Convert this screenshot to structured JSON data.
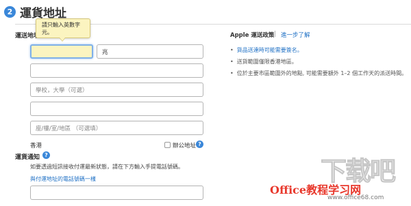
{
  "header": {
    "step_number": "2",
    "title": "運貨地址"
  },
  "form": {
    "address_label": "運送地址",
    "tooltip_text": "請只輸入英數字元。",
    "first_name_value": "",
    "last_name_value": "兆",
    "address_line1_value": "",
    "address_line2_placeholder": "學校，大學（可選）",
    "address_line3_value": "",
    "address_line4_placeholder": "座/樓/室/地區 （可選填）",
    "region": "香港",
    "office_checkbox_label": "辦公地址",
    "notify_label": "運貨通知",
    "notify_description": "如要透過短訊接收付運最新狀態，請在下方輸入手提電話號碼。",
    "notify_link": "與付運地址的電話號碼一樣",
    "phone_value": ""
  },
  "policy": {
    "title": "Apple 運送政策",
    "separator": "|",
    "learn_more": "進一步了解",
    "bullets": [
      "貨品送達時可能需要簽名。",
      "送貨範圍僅限香港地區。",
      "位於主要市區範圍外的地點, 可能需要額外 1–2 個工作天的派送時間。"
    ]
  },
  "watermark": {
    "logo_text": "下载吧",
    "brand": "Office教程学习网",
    "url": "www.office68.com"
  }
}
